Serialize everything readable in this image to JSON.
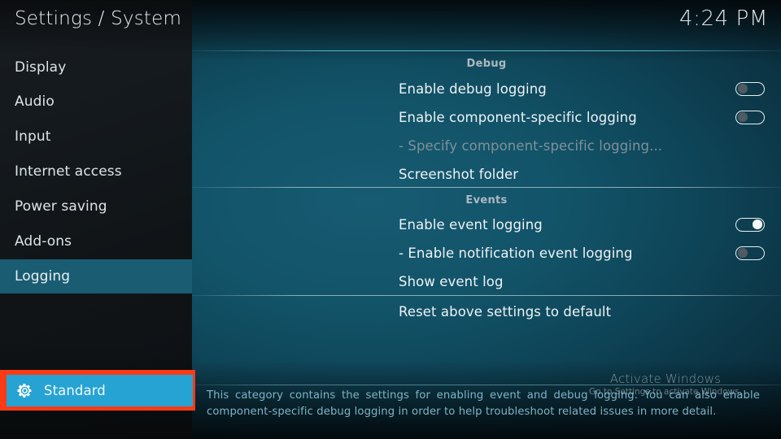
{
  "header": {
    "title": "Settings / System",
    "clock": "4:24 PM"
  },
  "sidebar": {
    "items": [
      {
        "label": "Display",
        "selected": false
      },
      {
        "label": "Audio",
        "selected": false
      },
      {
        "label": "Input",
        "selected": false
      },
      {
        "label": "Internet access",
        "selected": false
      },
      {
        "label": "Power saving",
        "selected": false
      },
      {
        "label": "Add-ons",
        "selected": false
      },
      {
        "label": "Logging",
        "selected": true
      }
    ],
    "level_button": {
      "label": "Standard",
      "icon": "gear-icon",
      "highlight_color": "#fc3a16",
      "button_color": "#26a3d3"
    }
  },
  "content": {
    "groups": [
      {
        "title": "Debug",
        "rows": [
          {
            "label": "Enable debug logging",
            "control": "toggle",
            "value": "off",
            "disabled": false
          },
          {
            "label": "Enable component-specific logging",
            "control": "toggle",
            "value": "off",
            "disabled": false
          },
          {
            "label": "- Specify component-specific logging...",
            "control": "none",
            "value": "",
            "disabled": true
          },
          {
            "label": "Screenshot folder",
            "control": "none",
            "value": "",
            "disabled": false
          }
        ]
      },
      {
        "title": "Events",
        "rows": [
          {
            "label": "Enable event logging",
            "control": "toggle",
            "value": "on",
            "disabled": false
          },
          {
            "label": "- Enable notification event logging",
            "control": "toggle",
            "value": "off",
            "disabled": false
          },
          {
            "label": "Show event log",
            "control": "none",
            "value": "",
            "disabled": false
          }
        ]
      },
      {
        "title": "",
        "rows": [
          {
            "label": "Reset above settings to default",
            "control": "none",
            "value": "",
            "disabled": false
          }
        ]
      }
    ]
  },
  "description": {
    "line1": "This category contains the settings for enabling event and debug logging. You can also enable",
    "line2": "component-specific debug logging in order to help troubleshoot related issues in more detail."
  },
  "watermark": {
    "title": "Activate Windows",
    "subtitle": "Go to Settings to activate Windows."
  },
  "colors": {
    "accent_teal": "#1a5c71",
    "panel_blue": "#125368",
    "highlight_red": "#fc3a16",
    "button_blue": "#26a3d3",
    "description_text": "#7fb3c6"
  }
}
